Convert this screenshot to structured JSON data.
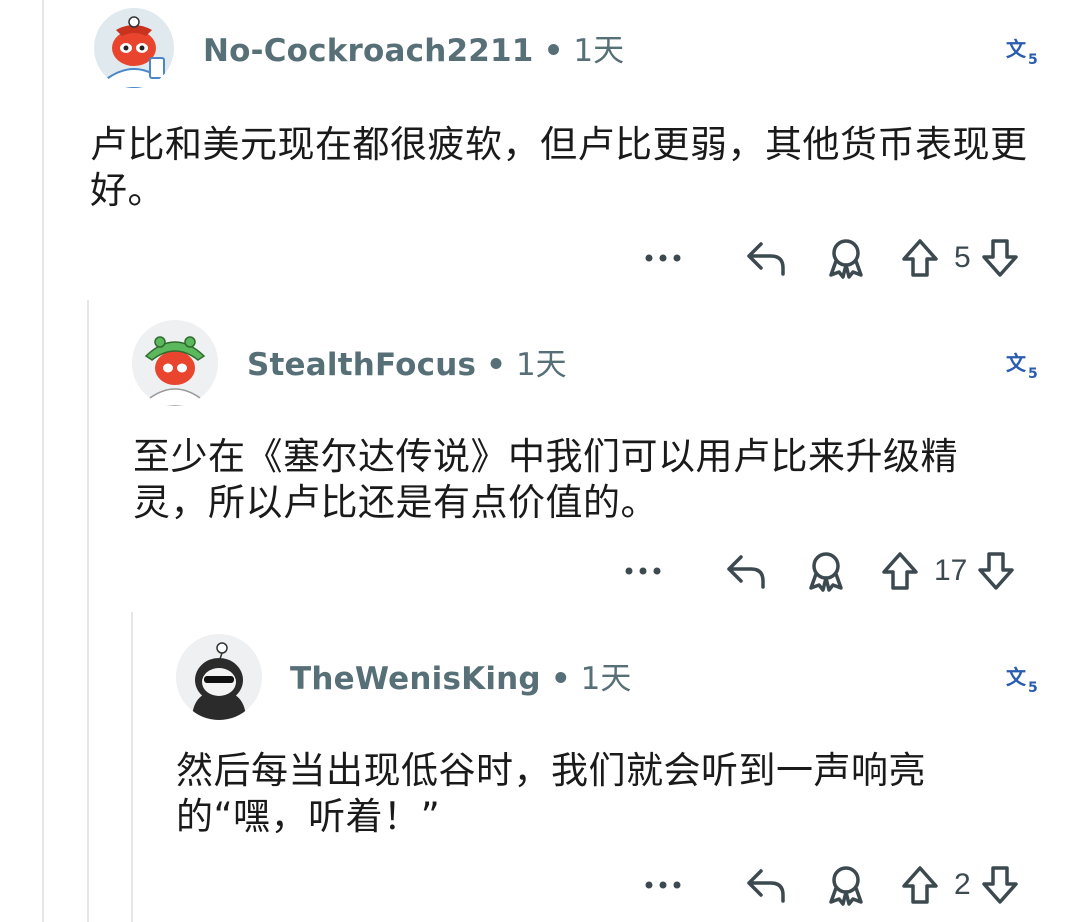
{
  "comments": [
    {
      "username": "No-Cockroach2211",
      "separator": "•",
      "time": "1天",
      "body": "卢比和美元现在都很疲软，但卢比更弱，其他货币表现更好。",
      "votes": "5",
      "avatar_icon": "snoo-red-avatar-icon"
    },
    {
      "username": "StealthFocus",
      "separator": "•",
      "time": "1天",
      "body": "至少在《塞尔达传说》中我们可以用卢比来升级精灵，所以卢比还是有点价值的。",
      "votes": "17",
      "avatar_icon": "snoo-green-hat-avatar-icon"
    },
    {
      "username": "TheWenisKing",
      "separator": "•",
      "time": "1天",
      "body": "然后每当出现低谷时，我们就会听到一声响亮的“嘿，听着！”",
      "votes": "2",
      "avatar_icon": "snoo-black-hood-avatar-icon"
    }
  ],
  "colors": {
    "username": "#576f76",
    "translate": "#2a5db0",
    "text": "#1a1a1b",
    "thread_line": "#e4e6e8"
  }
}
